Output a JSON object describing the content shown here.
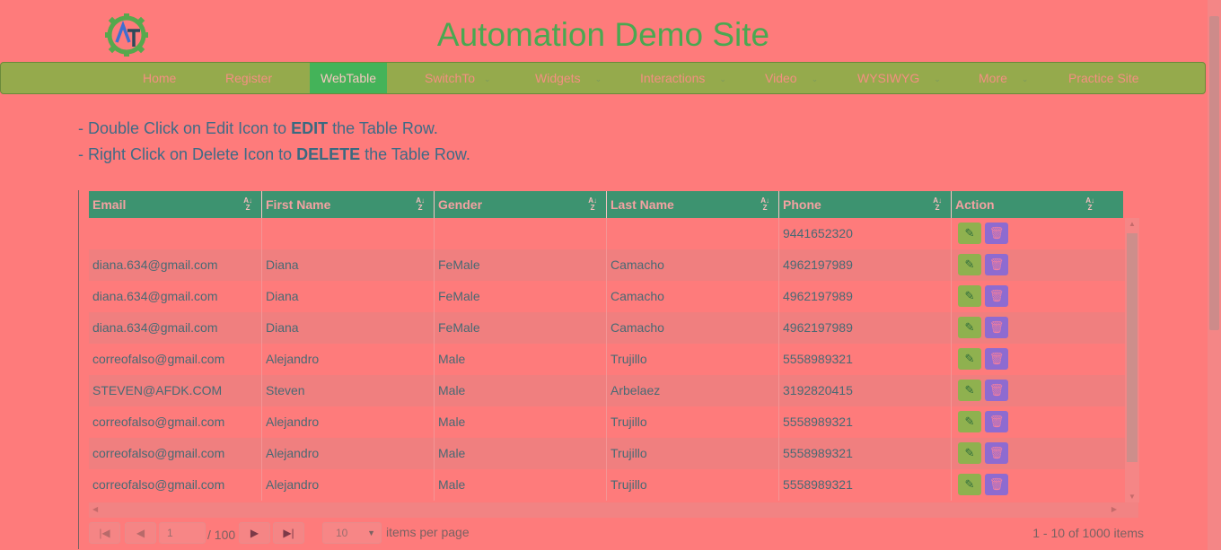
{
  "site_title": "Automation Demo Site",
  "nav": [
    {
      "label": "Home",
      "dropdown": false,
      "active": false
    },
    {
      "label": "Register",
      "dropdown": false,
      "active": false
    },
    {
      "label": "WebTable",
      "dropdown": false,
      "active": true
    },
    {
      "label": "SwitchTo",
      "dropdown": true,
      "active": false
    },
    {
      "label": "Widgets",
      "dropdown": true,
      "active": false
    },
    {
      "label": "Interactions",
      "dropdown": true,
      "active": false
    },
    {
      "label": "Video",
      "dropdown": true,
      "active": false
    },
    {
      "label": "WYSIWYG",
      "dropdown": true,
      "active": false
    },
    {
      "label": "More",
      "dropdown": true,
      "active": false
    },
    {
      "label": "Practice Site",
      "dropdown": false,
      "active": false
    }
  ],
  "instructions": {
    "line1_pre": "- Double Click on Edit Icon to ",
    "line1_bold": "EDIT",
    "line1_post": " the Table Row.",
    "line2_pre": "- Right Click on Delete Icon to ",
    "line2_bold": "DELETE",
    "line2_post": " the Table Row."
  },
  "table": {
    "columns": [
      "Email",
      "First Name",
      "Gender",
      "Last Name",
      "Phone",
      "Action"
    ],
    "sort_icon": "sort-alpha-icon",
    "rows": [
      [
        "",
        "",
        "",
        "",
        "9441652320"
      ],
      [
        "diana.634@gmail.com",
        "Diana",
        "FeMale",
        "Camacho",
        "4962197989"
      ],
      [
        "diana.634@gmail.com",
        "Diana",
        "FeMale",
        "Camacho",
        "4962197989"
      ],
      [
        "diana.634@gmail.com",
        "Diana",
        "FeMale",
        "Camacho",
        "4962197989"
      ],
      [
        "correofalso@gmail.com",
        "Alejandro",
        "Male",
        "Trujillo",
        "5558989321"
      ],
      [
        "STEVEN@AFDK.COM",
        "Steven",
        "Male",
        "Arbelaez",
        "3192820415"
      ],
      [
        "correofalso@gmail.com",
        "Alejandro",
        "Male",
        "Trujillo",
        "5558989321"
      ],
      [
        "correofalso@gmail.com",
        "Alejandro",
        "Male",
        "Trujillo",
        "5558989321"
      ],
      [
        "correofalso@gmail.com",
        "Alejandro",
        "Male",
        "Trujillo",
        "5558989321"
      ]
    ]
  },
  "pager": {
    "current_page": "1",
    "total_pages": "/ 100",
    "per_page": "10",
    "per_page_label": "items per page",
    "info": "1 - 10 of 1000 items"
  },
  "colors": {
    "background": "#fe7b7b",
    "navbar": "#95aa4c",
    "nav_active": "#44b359",
    "table_header": "#3d9370",
    "title": "#4aa851"
  }
}
